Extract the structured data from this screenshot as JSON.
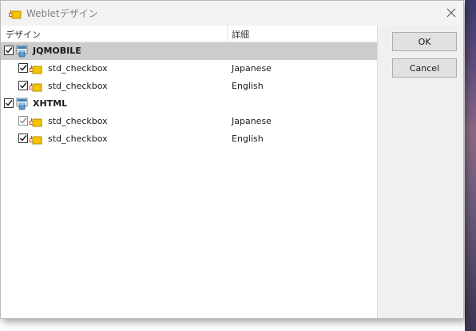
{
  "window": {
    "title": "Webletデザイン"
  },
  "columns": {
    "design": "デザイン",
    "detail": "詳細"
  },
  "groups": [
    {
      "name": "JQMOBILE",
      "checked": true,
      "children": [
        {
          "name": "std_checkbox",
          "detail": "Japanese",
          "checked": true,
          "disabled": false
        },
        {
          "name": "std_checkbox",
          "detail": "English",
          "checked": true,
          "disabled": false
        }
      ]
    },
    {
      "name": "XHTML",
      "checked": true,
      "children": [
        {
          "name": "std_checkbox",
          "detail": "Japanese",
          "checked": true,
          "disabled": true
        },
        {
          "name": "std_checkbox",
          "detail": "English",
          "checked": true,
          "disabled": false
        }
      ]
    }
  ],
  "buttons": {
    "ok": "OK",
    "cancel": "Cancel"
  },
  "colors": {
    "selection": "#cccccc",
    "folder_icon": "#f5c400",
    "dialog_bg": "#f0f0f0"
  }
}
